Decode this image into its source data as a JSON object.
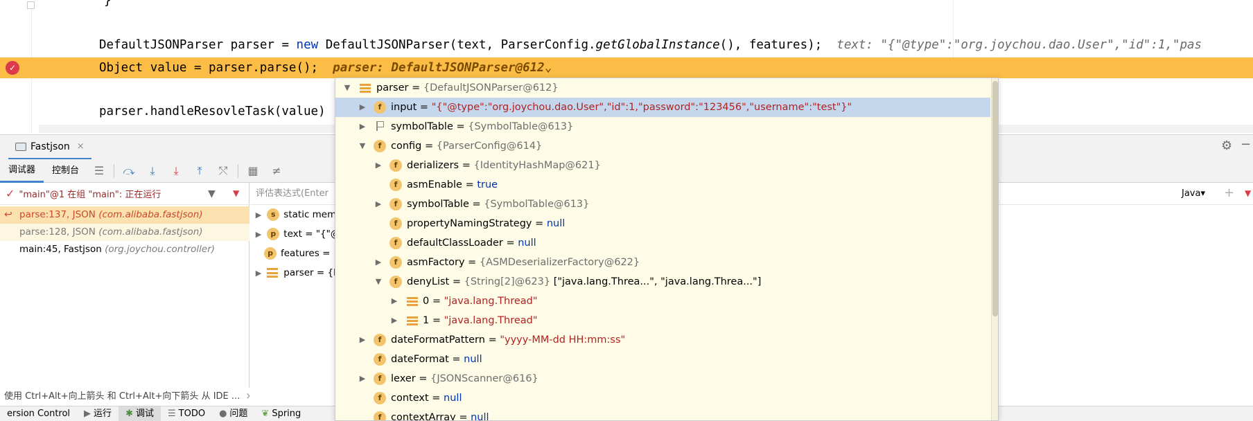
{
  "editor": {
    "line_brace": "}",
    "line1": {
      "type": "DefaultJSONParser",
      "var": "parser",
      "eq": "=",
      "new_kw": "new",
      "ctor": "DefaultJSONParser(",
      "arg1": "text",
      "cls": "ParserConfig.",
      "method": "getGlobalInstance",
      "rest": "(),",
      "arg2": "features",
      "end": ");",
      "inlay": "text: \"{\"@type\":\"org.joychou.dao.User\",\"id\":1,\"pas"
    },
    "line2": {
      "code": "Object value = parser.parse();",
      "inlay": "parser: DefaultJSONParser@612",
      "chevron": "⌄"
    },
    "line3": {
      "code": "parser.handleResovleTask(value)"
    }
  },
  "tool_window": {
    "tab_label": "Fastjson",
    "close": "×",
    "toolbar": {
      "debugger": "调试器",
      "console": "控制台"
    }
  },
  "frames": {
    "thread": "\"main\"@1 在组 \"main\": 正在运行",
    "items": [
      {
        "loc": "parse:137, JSON",
        "pkg": "(com.alibaba.fastjson)"
      },
      {
        "loc": "parse:128, JSON",
        "pkg": "(com.alibaba.fastjson)"
      },
      {
        "loc": "main:45, Fastjson",
        "pkg": "(org.joychou.controller)"
      }
    ]
  },
  "eval": {
    "placeholder": "评估表达式(Enter",
    "lang": "Java",
    "lang_dd": "▾"
  },
  "vars": {
    "items": [
      {
        "badge": "s",
        "text": "static mem"
      },
      {
        "badge": "p",
        "text": "text = \"{\"@"
      },
      {
        "badge": "p",
        "text": "features ="
      },
      {
        "badge": "list",
        "text": "parser = {I"
      }
    ]
  },
  "popup": {
    "rows": [
      {
        "name": "parser",
        "eq": " = ",
        "ref": "{DefaultJSONParser@612}",
        "value": ""
      },
      {
        "name": "input",
        "eq": " = ",
        "ref": "",
        "value": "\"{\"@type\":\"org.joychou.dao.User\",\"id\":1,\"password\":\"123456\",\"username\":\"test\"}\""
      },
      {
        "name": "symbolTable",
        "eq": " = ",
        "ref": "{SymbolTable@613}",
        "value": ""
      },
      {
        "name": "config",
        "eq": " = ",
        "ref": "{ParserConfig@614}",
        "value": ""
      },
      {
        "name": "derializers",
        "eq": " = ",
        "ref": "{IdentityHashMap@621}",
        "value": ""
      },
      {
        "name": "asmEnable",
        "eq": " = ",
        "ref": "",
        "value": "true"
      },
      {
        "name": "symbolTable",
        "eq": " = ",
        "ref": "{SymbolTable@613}",
        "value": ""
      },
      {
        "name": "propertyNamingStrategy",
        "eq": " = ",
        "ref": "",
        "value": "null"
      },
      {
        "name": "defaultClassLoader",
        "eq": " = ",
        "ref": "",
        "value": "null"
      },
      {
        "name": "asmFactory",
        "eq": " = ",
        "ref": "{ASMDeserializerFactory@622}",
        "value": ""
      },
      {
        "name": "denyList",
        "eq": " = ",
        "ref": "{String[2]@623} ",
        "value": "[\"java.lang.Threa...\", \"java.lang.Threa...\"]"
      },
      {
        "name": "0",
        "eq": " = ",
        "ref": "",
        "value": "\"java.lang.Thread\""
      },
      {
        "name": "1",
        "eq": " = ",
        "ref": "",
        "value": "\"java.lang.Thread\""
      },
      {
        "name": "dateFormatPattern",
        "eq": " = ",
        "ref": "",
        "value": "\"yyyy-MM-dd HH:mm:ss\""
      },
      {
        "name": "dateFormat",
        "eq": " = ",
        "ref": "",
        "value": "null"
      },
      {
        "name": "lexer",
        "eq": " = ",
        "ref": "{JSONScanner@616}",
        "value": ""
      },
      {
        "name": "context",
        "eq": " = ",
        "ref": "",
        "value": "null"
      },
      {
        "name": "contextArray",
        "eq": " = ",
        "ref": "",
        "value": "null"
      }
    ]
  },
  "tip": "使用 Ctrl+Alt+向上箭头 和 Ctrl+Alt+向下箭头 从 IDE ...",
  "tip_close": "×",
  "statusbar": {
    "items": [
      "ersion Control",
      "运行",
      "调试",
      "TODO",
      "问题",
      "Spring"
    ]
  },
  "colors": {
    "highlight_line": "#fbbd45",
    "popup_bg": "#fefbe6",
    "selection": "#c4d7ed",
    "string": "#b22222",
    "keyword": "#0033b3"
  },
  "icons": {
    "breakpoint": "breakpoint-icon",
    "settings": "gear-icon",
    "filter": "filter-icon"
  }
}
